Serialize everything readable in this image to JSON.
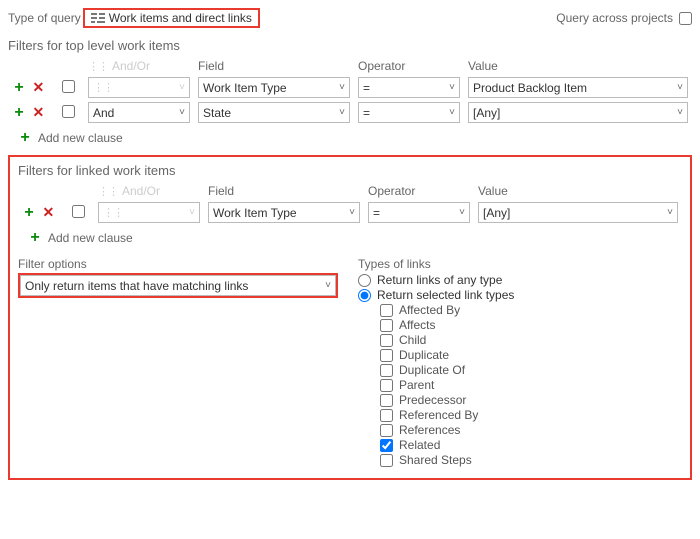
{
  "top": {
    "type_label": "Type of query",
    "type_value": "Work items and direct links",
    "across_label": "Query across projects"
  },
  "sections": {
    "top_filters_title": "Filters for top level work items",
    "linked_filters_title": "Filters for linked work items"
  },
  "headers": {
    "and_or": "And/Or",
    "field": "Field",
    "operator": "Operator",
    "value": "Value"
  },
  "top_filters": [
    {
      "and_or": "",
      "and_or_disabled": true,
      "field": "Work Item Type",
      "operator": "=",
      "value": "Product Backlog Item"
    },
    {
      "and_or": "And",
      "and_or_disabled": false,
      "field": "State",
      "operator": "=",
      "value": "[Any]"
    }
  ],
  "linked_filters": [
    {
      "and_or": "",
      "and_or_disabled": true,
      "field": "Work Item Type",
      "operator": "=",
      "value": "[Any]"
    }
  ],
  "add_clause_label": "Add new clause",
  "filter_options": {
    "label": "Filter options",
    "value": "Only return items that have matching links"
  },
  "link_types": {
    "label": "Types of links",
    "radio_any": "Return links of any type",
    "radio_selected": "Return selected link types",
    "selected_radio": "selected",
    "items": [
      {
        "label": "Affected By",
        "checked": false
      },
      {
        "label": "Affects",
        "checked": false
      },
      {
        "label": "Child",
        "checked": false
      },
      {
        "label": "Duplicate",
        "checked": false
      },
      {
        "label": "Duplicate Of",
        "checked": false
      },
      {
        "label": "Parent",
        "checked": false
      },
      {
        "label": "Predecessor",
        "checked": false
      },
      {
        "label": "Referenced By",
        "checked": false
      },
      {
        "label": "References",
        "checked": false
      },
      {
        "label": "Related",
        "checked": true
      },
      {
        "label": "Shared Steps",
        "checked": false
      }
    ]
  }
}
